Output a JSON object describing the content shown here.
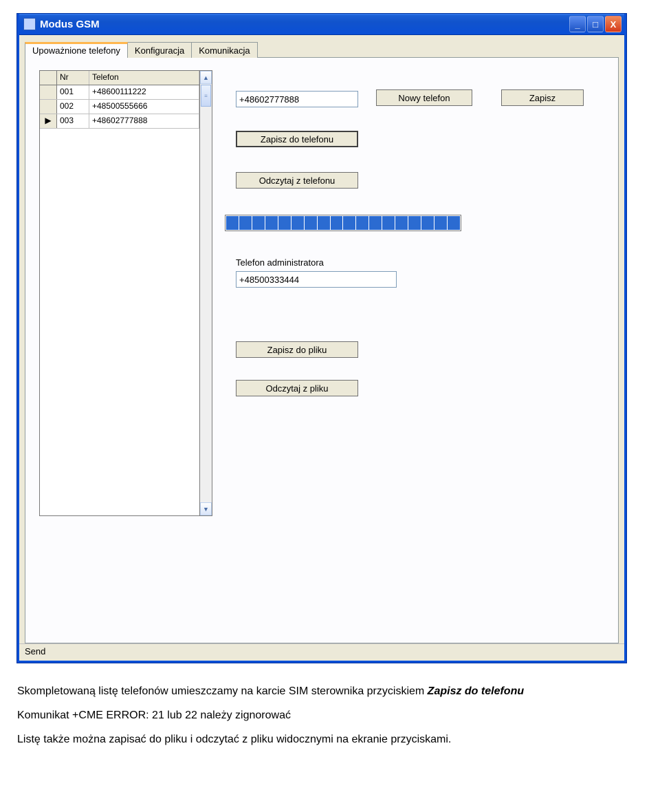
{
  "window": {
    "title": "Modus GSM",
    "buttons": {
      "minimize": "_",
      "maximize": "□",
      "close": "X"
    }
  },
  "tabs": [
    {
      "label": "Upoważnione telefony",
      "active": true
    },
    {
      "label": "Konfiguracja",
      "active": false
    },
    {
      "label": "Komunikacja",
      "active": false
    }
  ],
  "grid": {
    "headers": {
      "nr": "Nr",
      "telefon": "Telefon"
    },
    "rows": [
      {
        "marker": "",
        "nr": "001",
        "telefon": "+48600111222"
      },
      {
        "marker": "",
        "nr": "002",
        "telefon": "+48500555666"
      },
      {
        "marker": "▶",
        "nr": "003",
        "telefon": "+48602777888"
      }
    ]
  },
  "inputs": {
    "phone": "+48602777888",
    "admin_label": "Telefon administratora",
    "admin_phone": "+48500333444"
  },
  "buttons": {
    "new_phone": "Nowy telefon",
    "save": "Zapisz",
    "save_to_phone": "Zapisz do telefonu",
    "read_from_phone": "Odczytaj z telefonu",
    "save_to_file": "Zapisz do pliku",
    "read_from_file": "Odczytaj z pliku"
  },
  "progress": {
    "segments": 18
  },
  "statusbar": {
    "text": "Send"
  },
  "doc": {
    "para1_pre": "Skompletowaną listę telefonów umieszczamy na karcie SIM sterownika przyciskiem ",
    "para1_btn": "Zapisz do telefonu",
    "para2": "Komunikat  +CME ERROR: 21 lub 22 należy zignorować",
    "para3": "Listę także można zapisać do pliku i odczytać z pliku widocznymi na ekranie przyciskami."
  }
}
